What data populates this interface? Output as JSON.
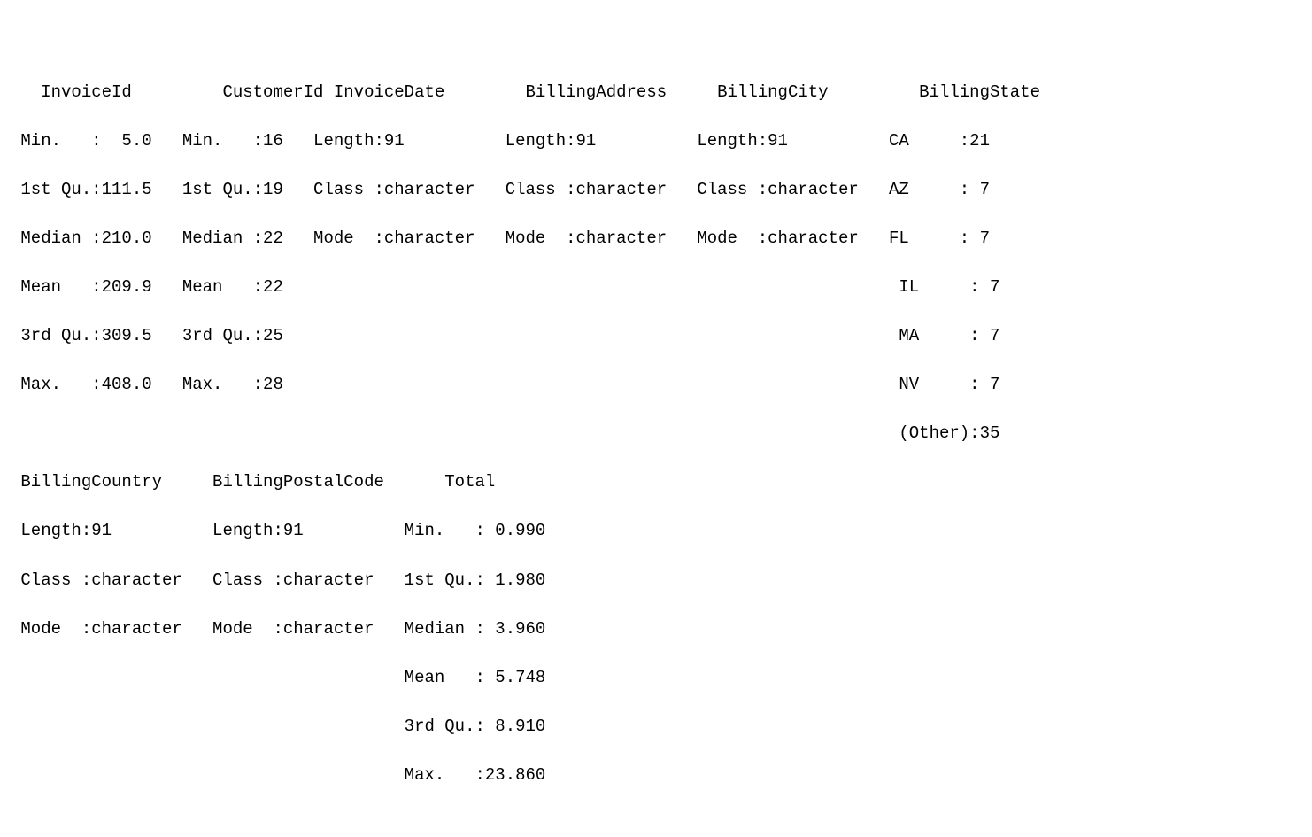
{
  "summary": {
    "row1": {
      "headers": "  InvoiceId         CustomerId InvoiceDate        BillingAddress     BillingCity         BillingState",
      "lines": [
        "Min.   :  5.0   Min.   :16   Length:91          Length:91          Length:91          CA     :21  ",
        "1st Qu.:111.5   1st Qu.:19   Class :character   Class :character   Class :character   AZ     : 7  ",
        "Median :210.0   Median :22   Mode  :character   Mode  :character   Mode  :character   FL     : 7  ",
        "Mean   :209.9   Mean   :22                                                             IL     : 7  ",
        "3rd Qu.:309.5   3rd Qu.:25                                                             MA     : 7  ",
        "Max.   :408.0   Max.   :28                                                             NV     : 7  ",
        "                                                                                       (Other):35  "
      ]
    },
    "row2": {
      "headers": "BillingCountry     BillingPostalCode      Total       ",
      "lines": [
        "Length:91          Length:91          Min.   : 0.990  ",
        "Class :character   Class :character   1st Qu.: 1.980  ",
        "Mode  :character   Mode  :character   Median : 3.960  ",
        "                                      Mean   : 5.748  ",
        "                                      3rd Qu.: 8.910  ",
        "                                      Max.   :23.860  "
      ]
    }
  }
}
